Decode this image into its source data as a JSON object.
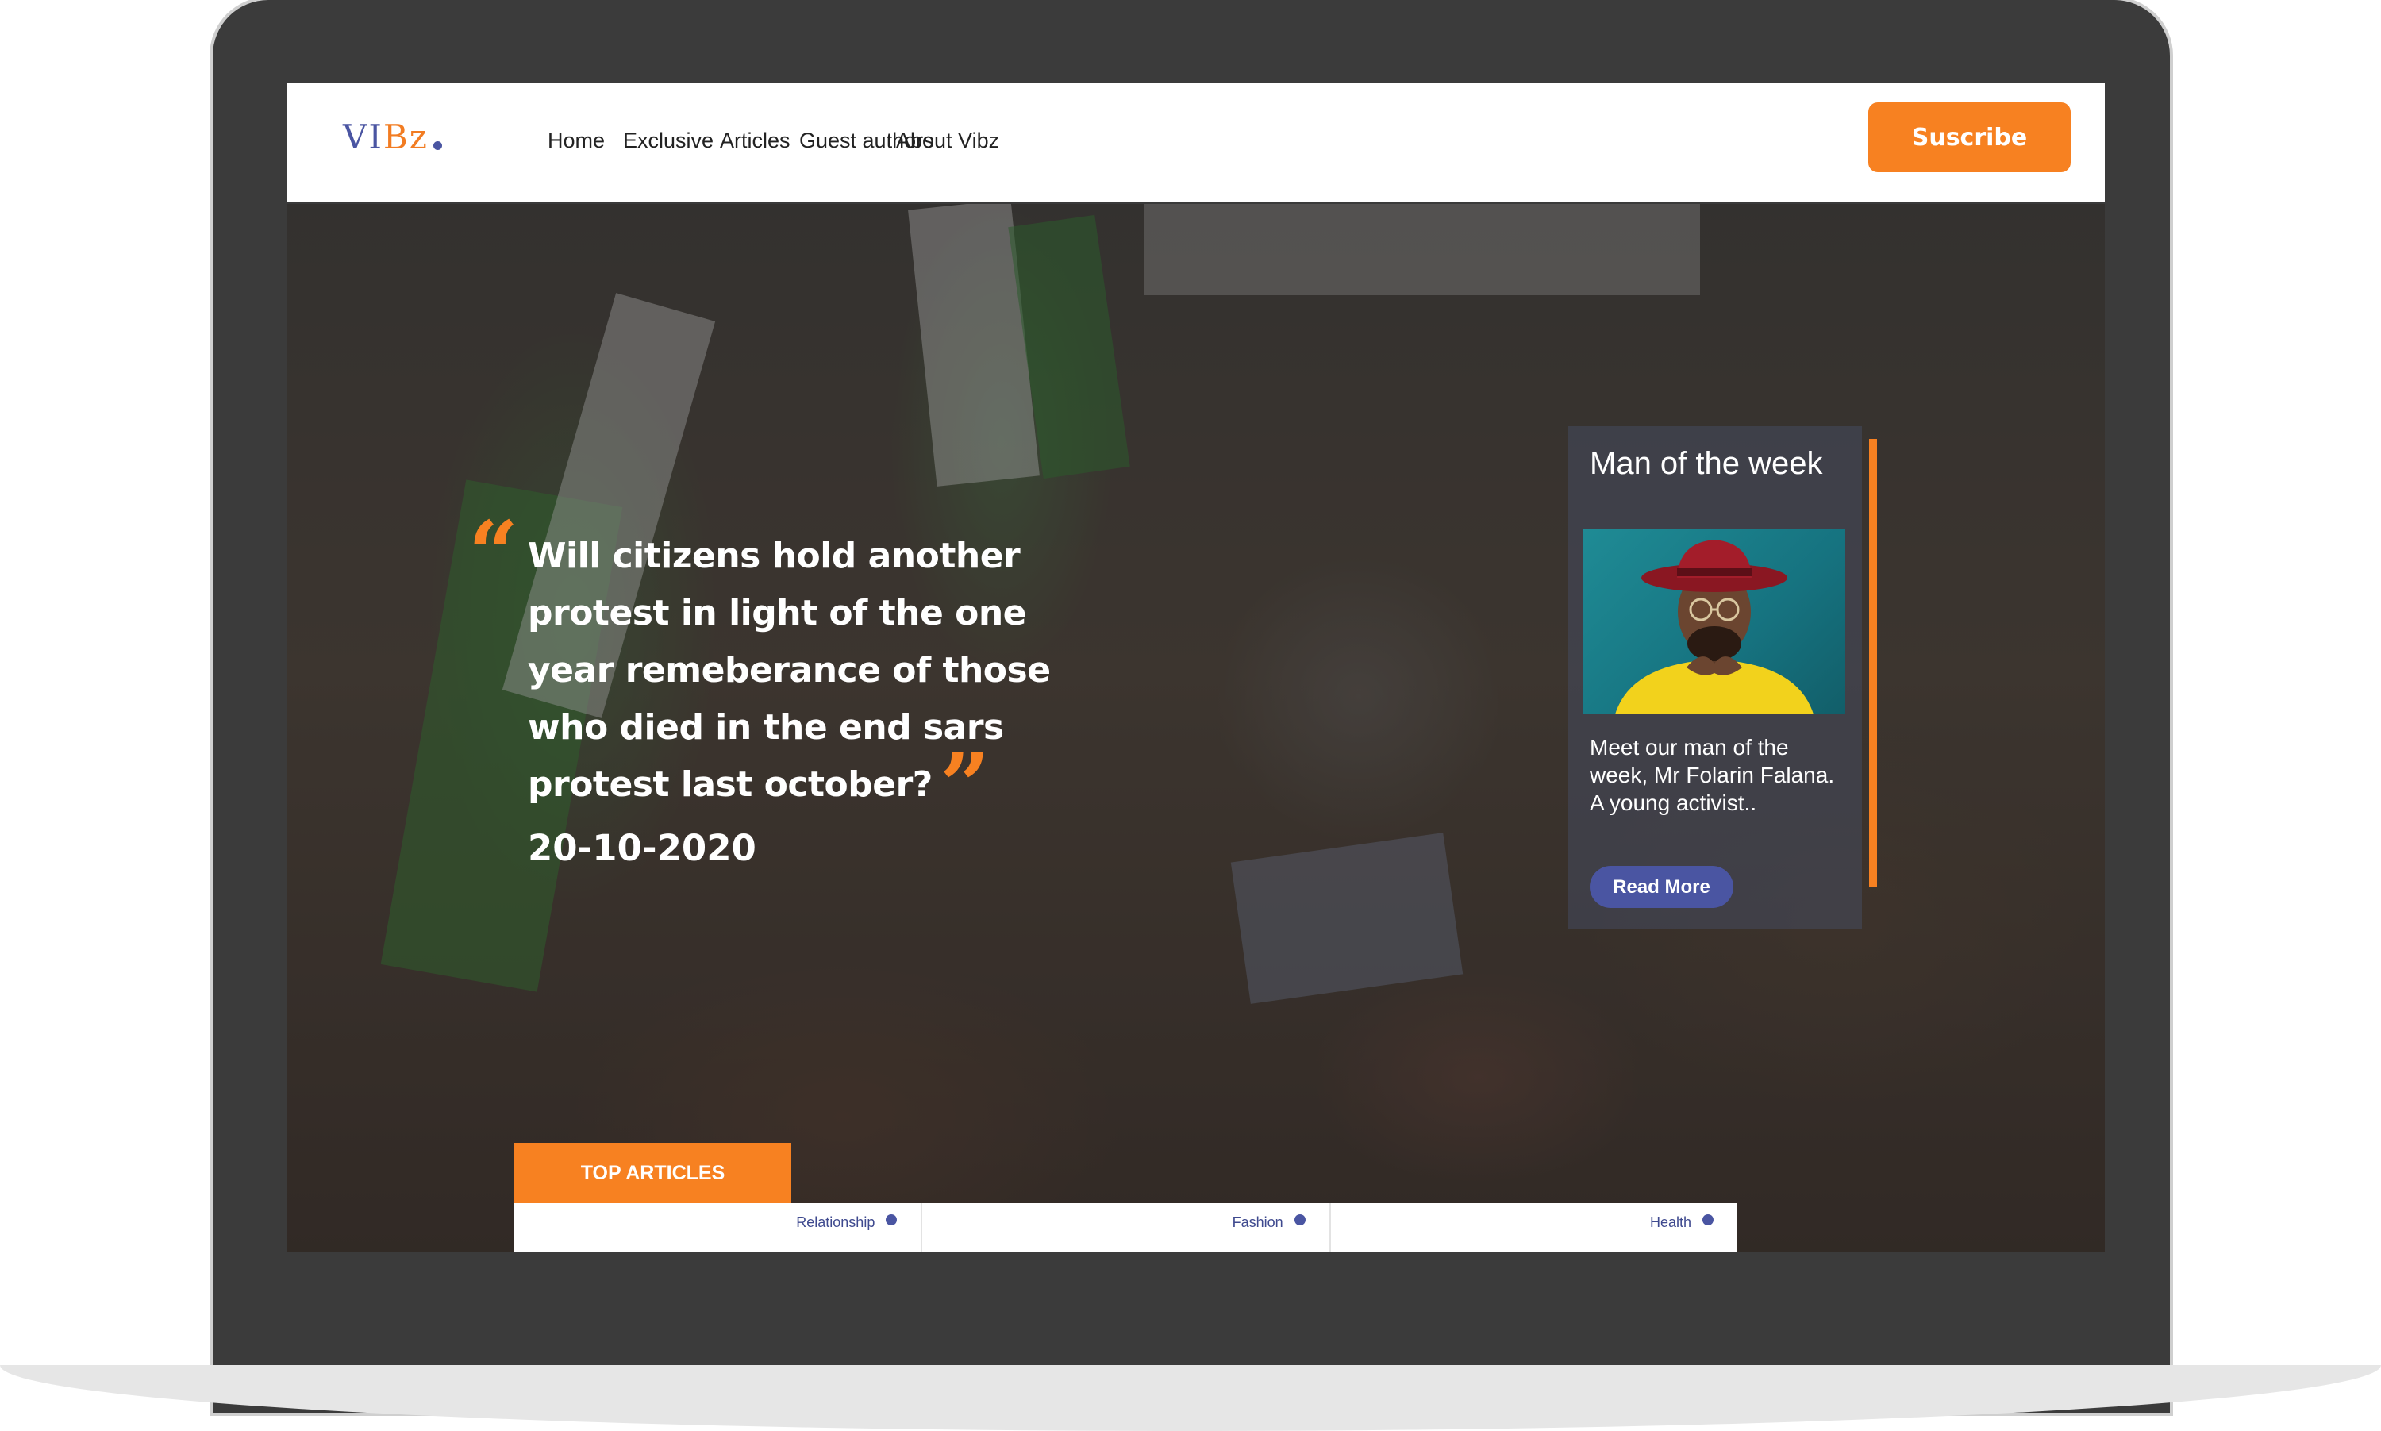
{
  "brand": {
    "logo_part1": "VI",
    "logo_part2": "Bz"
  },
  "nav": {
    "items": [
      {
        "label": "Home"
      },
      {
        "label": "Exclusive"
      },
      {
        "label": "Articles"
      },
      {
        "label": "Guest authors"
      },
      {
        "label": "About Vibz"
      }
    ],
    "subscribe_label": "Suscribe"
  },
  "hero": {
    "headline": "Will citizens hold another protest in light of the one year remeberance of those who died in the end sars protest last october?",
    "date": "20-10-2020"
  },
  "man_of_week": {
    "title": "Man of the week",
    "description": "Meet our man of the week, Mr Folarin Falana. A young activist..",
    "button_label": "Read More"
  },
  "top_articles": {
    "tab_label": "TOP ARTICLES",
    "categories": [
      {
        "label": "Relationship"
      },
      {
        "label": "Fashion"
      },
      {
        "label": "Health"
      }
    ]
  },
  "colors": {
    "accent": "#f78121",
    "brand_blue": "#4a55a2",
    "frame": "#3b3b3b"
  }
}
